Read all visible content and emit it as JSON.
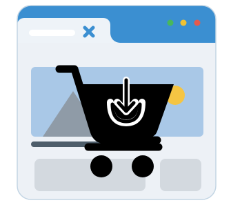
{
  "icon": {
    "kind": "browser-window-with-shopping-cart-download",
    "colors": {
      "window_bar": "#3b8fd1",
      "window_tab": "#eef3f8",
      "window_body": "#edf1f6",
      "window_outline": "#c3d5e4",
      "address_bar": "#ffffff",
      "tab_close_mark": "#3b8fd1",
      "dot_green": "#48b85c",
      "dot_yellow": "#f1c232",
      "dot_red": "#e55a4d",
      "banner": "#a9c8e7",
      "mountain": "#8f9ba7",
      "sun": "#f5c543",
      "placeholder_block": "#d3d9df",
      "text_line": "#4d5d6a",
      "cart": "#000000",
      "download_arrow": "#000000"
    },
    "elements": [
      "browser-window",
      "tab",
      "window-controls",
      "image-banner",
      "shopping-cart-icon",
      "download-arrow-icon"
    ]
  }
}
